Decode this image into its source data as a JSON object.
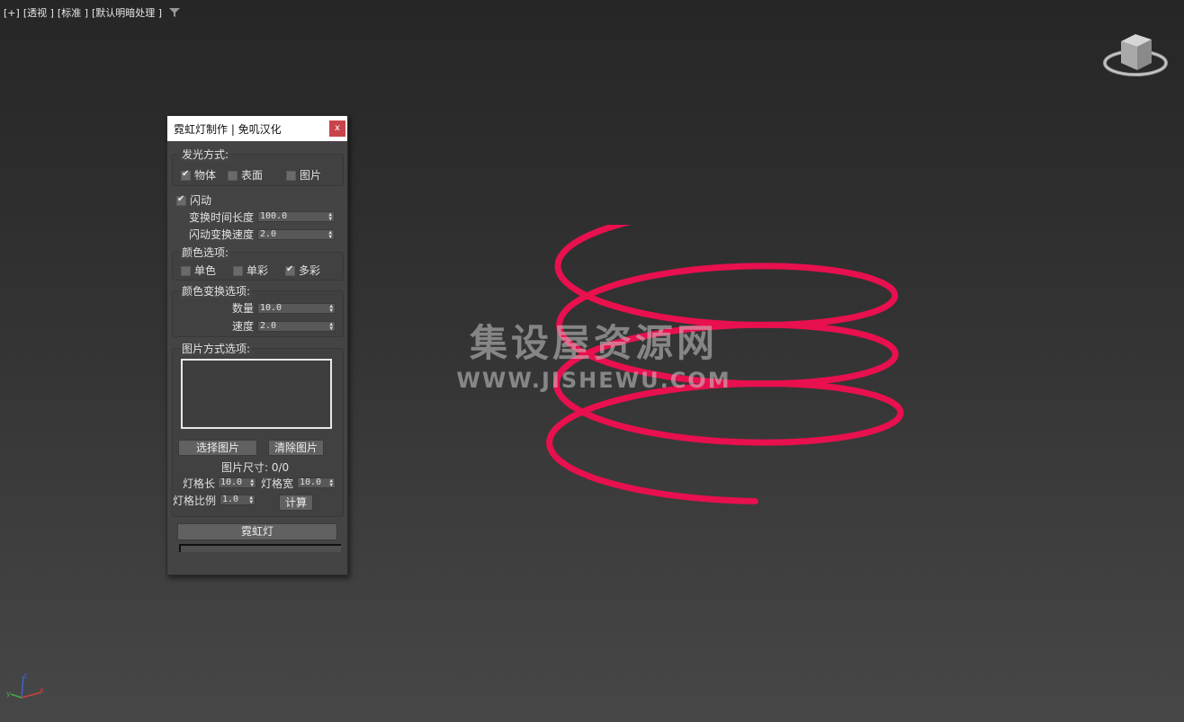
{
  "viewport": {
    "label_plus": "[+]",
    "label_view": "[透视 ]",
    "label_shading": "[标准 ]",
    "label_lighting": "[默认明暗处理 ]",
    "filter_icon": "funnel-icon"
  },
  "watermark": {
    "cn": "集设屋资源网",
    "en": "WWW.JISHEWU.COM"
  },
  "colors": {
    "neon": "#e8104e",
    "background_top": "#262626",
    "background_bottom": "#474747",
    "close_button": "#c8444a"
  },
  "dialog": {
    "title": "霓虹灯制作 | 免叽汉化",
    "close_label": "x",
    "emission": {
      "title": "发光方式:",
      "options": [
        {
          "label": "物体",
          "checked": true
        },
        {
          "label": "表面",
          "checked": false
        },
        {
          "label": "图片",
          "checked": false
        }
      ]
    },
    "flash": {
      "label": "闪动",
      "checked": true,
      "duration_label": "变换时间长度",
      "duration_value": "100.0",
      "speed_label": "闪动变换速度",
      "speed_value": "2.0"
    },
    "color_options": {
      "title": "颜色选项:",
      "options": [
        {
          "label": "单色",
          "checked": false
        },
        {
          "label": "单彩",
          "checked": false
        },
        {
          "label": "多彩",
          "checked": true
        }
      ]
    },
    "color_transform": {
      "title": "颜色变换选项:",
      "count_label": "数量",
      "count_value": "10.0",
      "speed_label": "速度",
      "speed_value": "2.0"
    },
    "image_options": {
      "title": "图片方式选项:",
      "select_button": "选择图片",
      "clear_button": "清除图片",
      "size_label": "图片尺寸:",
      "size_value": "0/0",
      "cell_length_label": "灯格长",
      "cell_length_value": "10.0",
      "cell_width_label": "灯格宽",
      "cell_width_value": "10.0",
      "cell_ratio_label": "灯格比例",
      "cell_ratio_value": "1.0",
      "calc_button": "计算"
    },
    "neon_button": "霓虹灯",
    "progress": 0
  }
}
